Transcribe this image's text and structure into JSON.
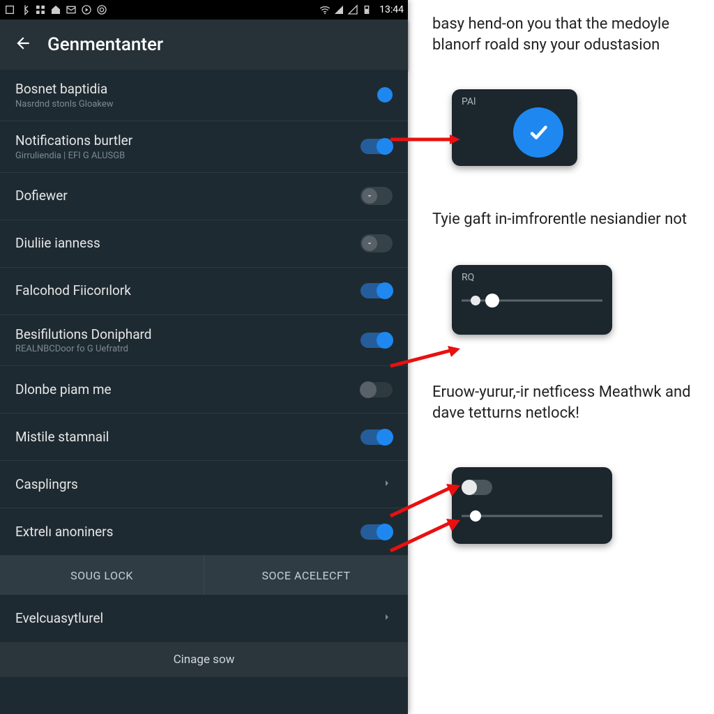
{
  "statusbar": {
    "time": "13:44"
  },
  "appbar": {
    "title": "Genmentanter"
  },
  "rows": [
    {
      "title": "Bosnet baptidia",
      "sub": "Nasrdnd stonls Gloakew",
      "ctrl": "dot"
    },
    {
      "title": "Notifications burtler",
      "sub": "Girruliendia | EFI G ALUSGB",
      "ctrl": "toggle_on"
    },
    {
      "title": "Dofiewer",
      "sub": "",
      "ctrl": "expand"
    },
    {
      "title": "Diuliie ianness",
      "sub": "",
      "ctrl": "expand"
    },
    {
      "title": "Falcohod Fiicorılork",
      "sub": "",
      "ctrl": "toggle_on"
    },
    {
      "title": "Besifilutions Doniphard",
      "sub": "REALNBCDoor fo G Uefratrd",
      "ctrl": "toggle_on"
    },
    {
      "title": "Dlonbe piam me",
      "sub": "",
      "ctrl": "toggle_dash"
    },
    {
      "title": "Mistile stamnail",
      "sub": "",
      "ctrl": "toggle_on"
    },
    {
      "title": "Casplingrs",
      "sub": "",
      "ctrl": "chevron"
    },
    {
      "title": "Extrelı anoniners",
      "sub": "",
      "ctrl": "toggle_on"
    }
  ],
  "tabs": {
    "left": "SOUG LOCK",
    "right": "SOCE ACELECFT"
  },
  "moreRow": {
    "title": "Evelcuasytlurel"
  },
  "bottomButton": "Cinage sow",
  "annot1": {
    "text": "basy hend-on you that the medoyle blanorf roald sny your odustasion",
    "cardLabel": "PAl"
  },
  "annot2": {
    "text": "Tyie gaft in-imfrorentle nesiandier not",
    "cardLabel": "RQ"
  },
  "annot3": {
    "text": "Eruow-yurur,-ir netficess Meathwk and dave tetturns netlock!"
  }
}
